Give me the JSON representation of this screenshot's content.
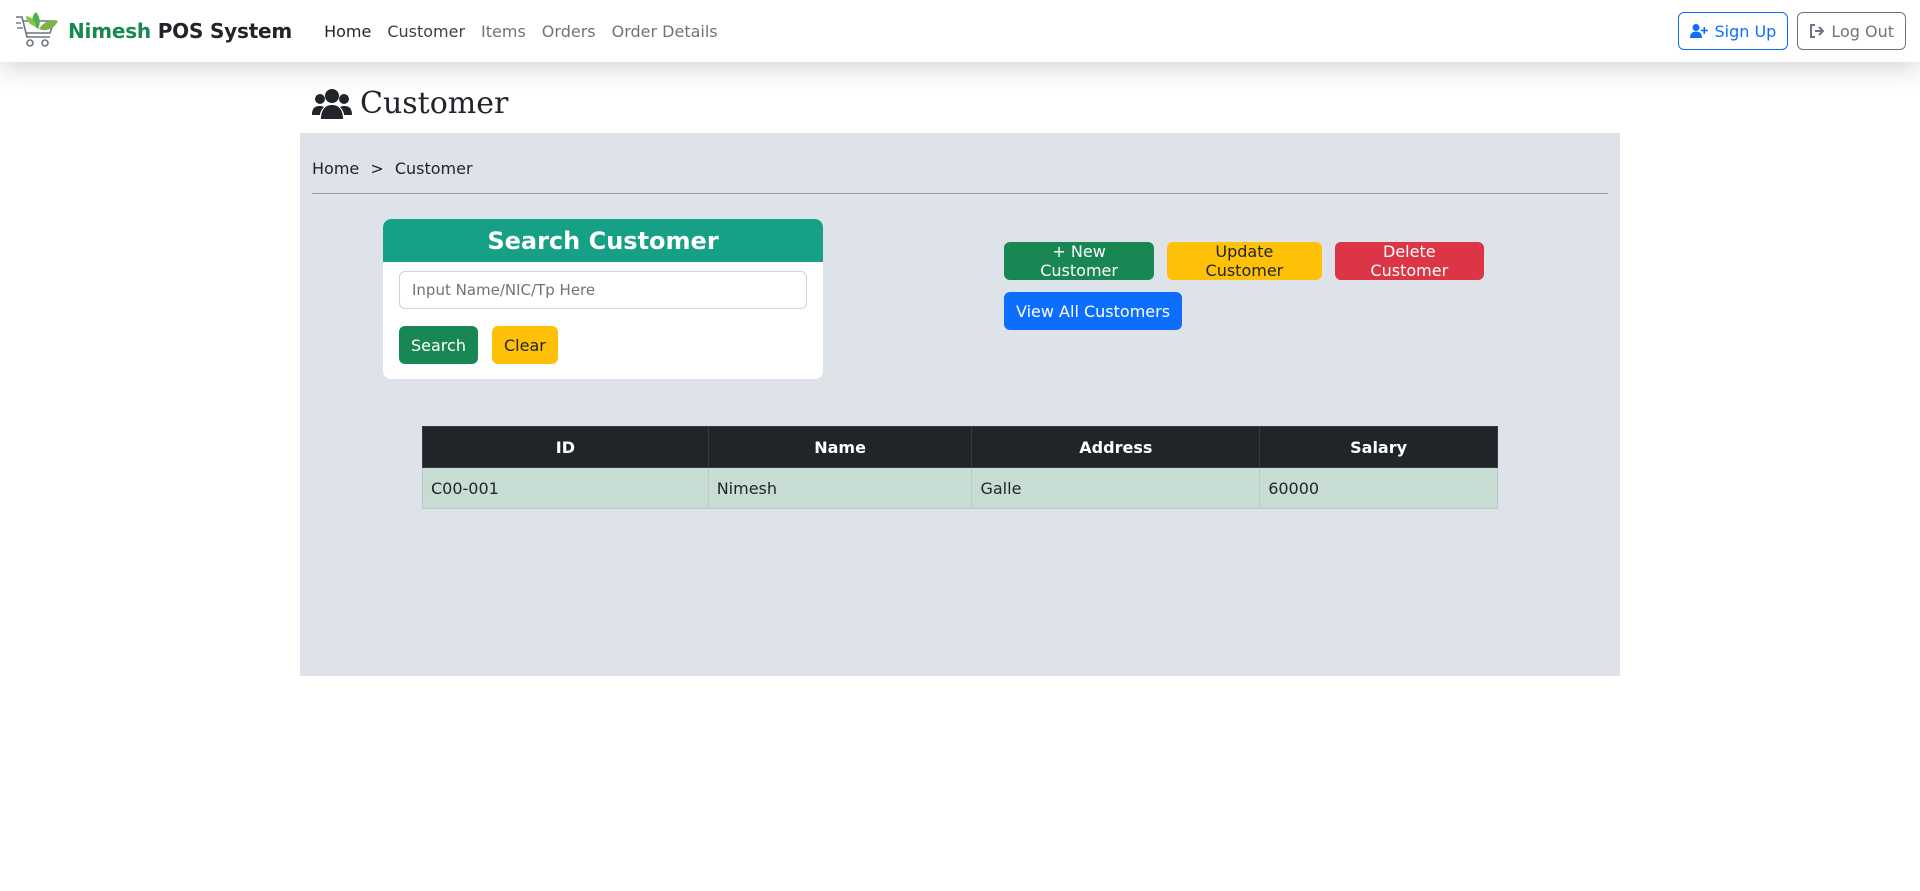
{
  "navbar": {
    "brand_first": "Nimesh",
    "brand_second": "POS System",
    "links": [
      "Home",
      "Customer",
      "Items",
      "Orders",
      "Order Details"
    ],
    "signup_label": "Sign Up",
    "logout_label": "Log Out"
  },
  "page": {
    "title": "Customer",
    "title_icon": "users-icon"
  },
  "breadcrumb": {
    "home": "Home",
    "separator": ">",
    "current": "Customer"
  },
  "search": {
    "header": "Search Customer",
    "placeholder": "Input Name/NIC/Tp Here",
    "value": "",
    "search_label": "Search",
    "clear_label": "Clear"
  },
  "actions": {
    "new_label": "+ New Customer",
    "update_label": "Update Customer",
    "delete_label": "Delete Customer",
    "view_all_label": "View All Customers"
  },
  "table": {
    "columns": [
      "ID",
      "Name",
      "Address",
      "Salary"
    ],
    "rows": [
      [
        "C00-001",
        "Nimesh",
        "Galle",
        "60000"
      ]
    ]
  },
  "colors": {
    "brand_green": "#198754",
    "search_header": "#16a085",
    "panel_bg": "#dee2e9",
    "row_bg": "#c7ddd3"
  }
}
